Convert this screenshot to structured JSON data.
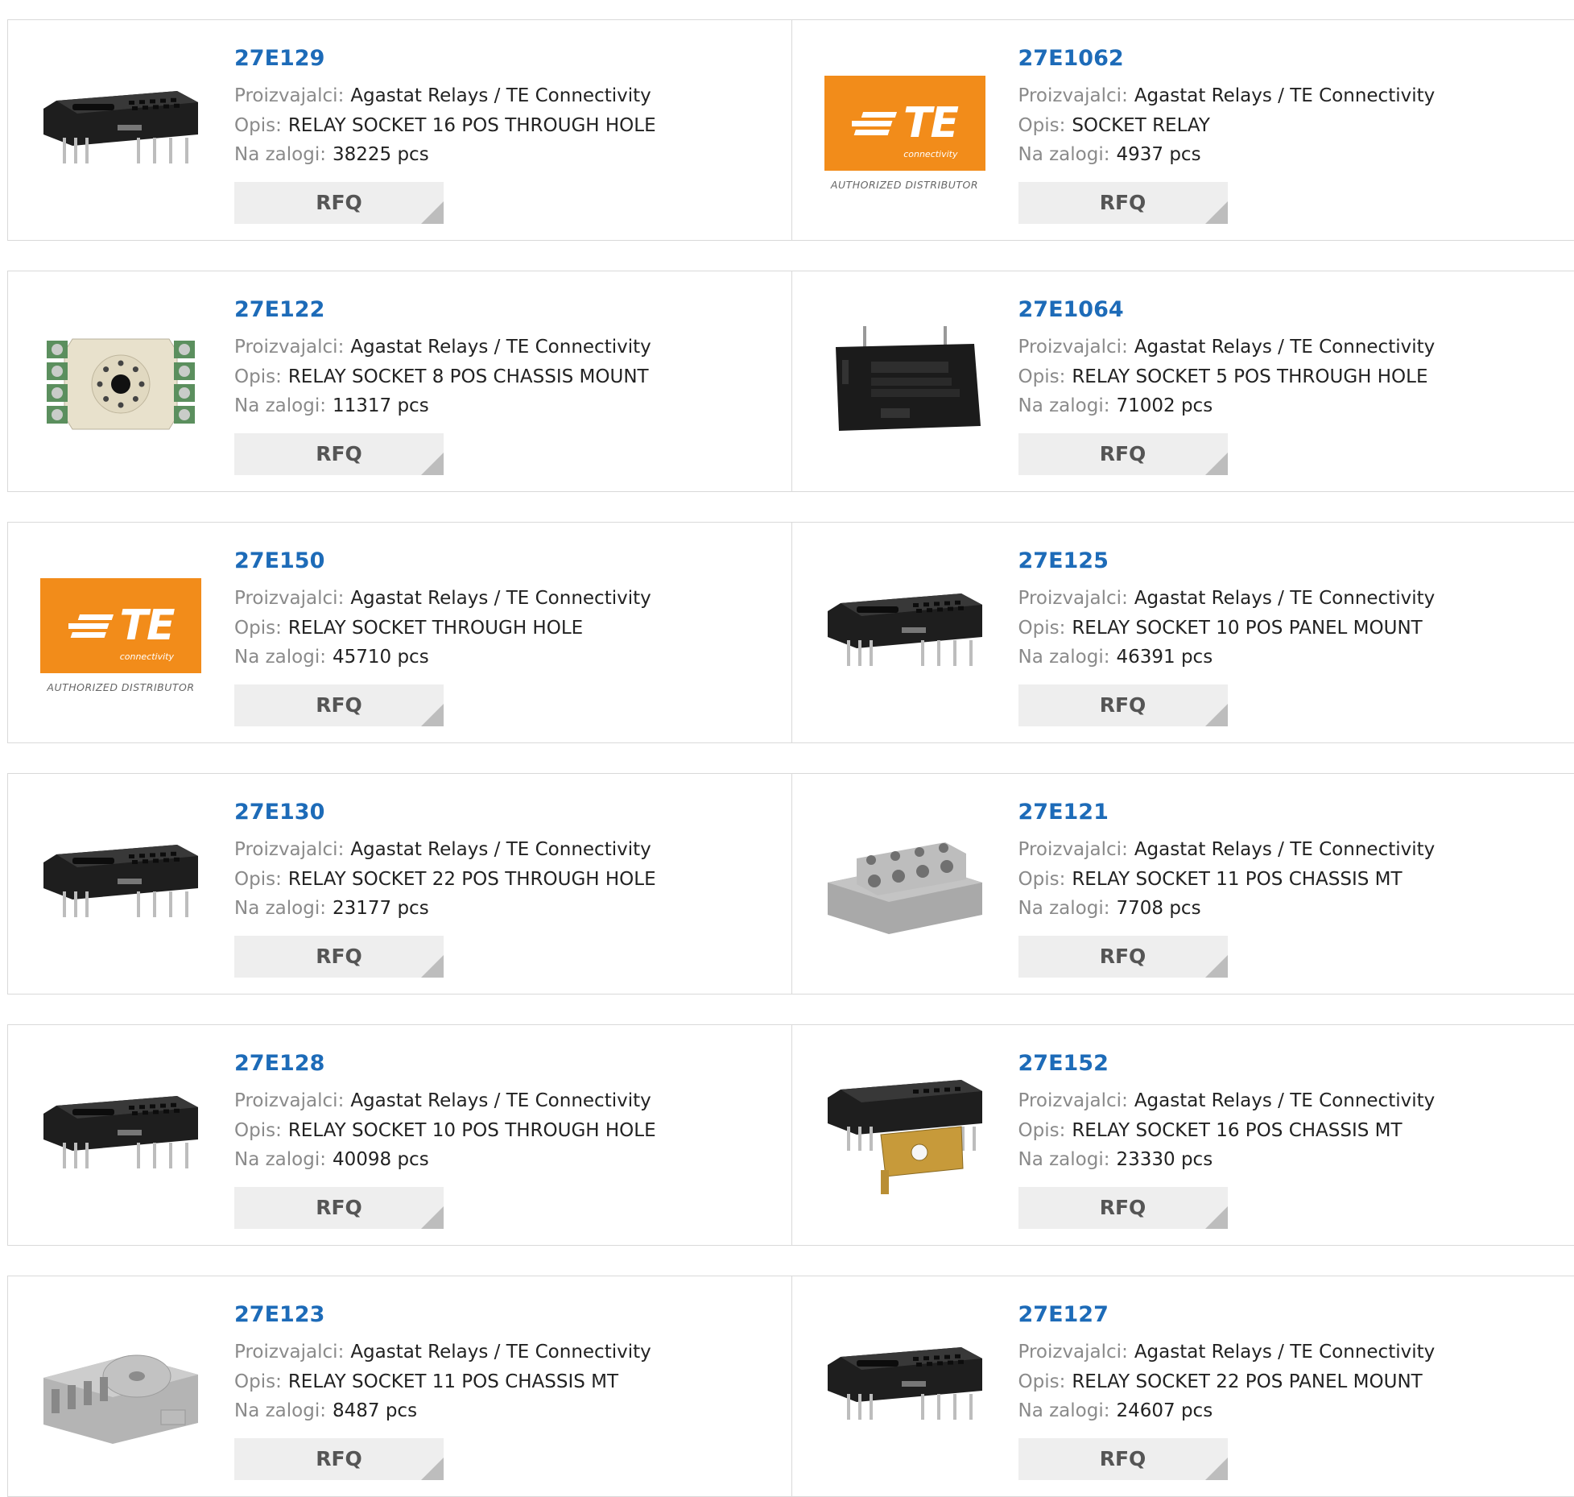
{
  "labels": {
    "manufacturer": "Proizvajalci:",
    "description": "Opis:",
    "stock": "Na zalogi:",
    "rfq": "RFQ"
  },
  "te_logo": {
    "text": "TE",
    "subtext": "connectivity",
    "badge": "AUTHORIZED DISTRIBUTOR",
    "color": "#f28c1a"
  },
  "products": [
    {
      "part": "27E129",
      "manufacturer": "Agastat Relays / TE Connectivity",
      "description": "RELAY SOCKET 16 POS THROUGH HOLE",
      "stock": "38225 pcs",
      "image": "black-relay-socket"
    },
    {
      "part": "27E1062",
      "manufacturer": "Agastat Relays / TE Connectivity",
      "description": "SOCKET RELAY",
      "stock": "4937 pcs",
      "image": "te-logo"
    },
    {
      "part": "27E122",
      "manufacturer": "Agastat Relays / TE Connectivity",
      "description": "RELAY SOCKET 8 POS CHASSIS MOUNT",
      "stock": "11317 pcs",
      "image": "beige-octal-socket"
    },
    {
      "part": "27E1064",
      "manufacturer": "Agastat Relays / TE Connectivity",
      "description": "RELAY SOCKET 5 POS THROUGH HOLE",
      "stock": "71002 pcs",
      "image": "black-relay-block"
    },
    {
      "part": "27E150",
      "manufacturer": "Agastat Relays / TE Connectivity",
      "description": "RELAY SOCKET THROUGH HOLE",
      "stock": "45710 pcs",
      "image": "te-logo"
    },
    {
      "part": "27E125",
      "manufacturer": "Agastat Relays / TE Connectivity",
      "description": "RELAY SOCKET 10 POS PANEL MOUNT",
      "stock": "46391 pcs",
      "image": "black-relay-socket"
    },
    {
      "part": "27E130",
      "manufacturer": "Agastat Relays / TE Connectivity",
      "description": "RELAY SOCKET 22 POS THROUGH HOLE",
      "stock": "23177 pcs",
      "image": "black-relay-socket"
    },
    {
      "part": "27E121",
      "manufacturer": "Agastat Relays / TE Connectivity",
      "description": "RELAY SOCKET 11 POS CHASSIS MT",
      "stock": "7708 pcs",
      "image": "gray-screw-socket"
    },
    {
      "part": "27E128",
      "manufacturer": "Agastat Relays / TE Connectivity",
      "description": "RELAY SOCKET 10 POS THROUGH HOLE",
      "stock": "40098 pcs",
      "image": "black-relay-socket"
    },
    {
      "part": "27E152",
      "manufacturer": "Agastat Relays / TE Connectivity",
      "description": "RELAY SOCKET 16 POS CHASSIS MT",
      "stock": "23330 pcs",
      "image": "black-socket-bracket"
    },
    {
      "part": "27E123",
      "manufacturer": "Agastat Relays / TE Connectivity",
      "description": "RELAY SOCKET 11 POS CHASSIS MT",
      "stock": "8487 pcs",
      "image": "gray-octal-socket"
    },
    {
      "part": "27E127",
      "manufacturer": "Agastat Relays / TE Connectivity",
      "description": "RELAY SOCKET 22 POS PANEL MOUNT",
      "stock": "24607 pcs",
      "image": "black-relay-socket"
    }
  ]
}
